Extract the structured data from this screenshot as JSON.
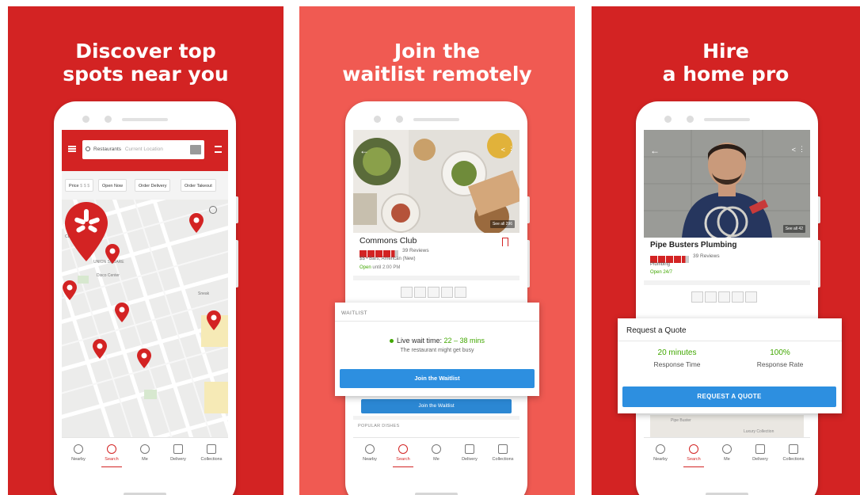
{
  "colors": {
    "brand_red": "#d32323",
    "coral": "#f05a52",
    "action_blue": "#2d8fe0",
    "success_green": "#41a700"
  },
  "panel1": {
    "headline": [
      "Discover top",
      "spots near you"
    ],
    "search": {
      "term": "Restaurants",
      "location": "Current Location"
    },
    "filters": [
      "Price",
      "Open Now",
      "Order Delivery",
      "Order Takeout"
    ],
    "price_symbols": "$ $ $",
    "map_labels": [
      "CENTER",
      "UNION SQUARE",
      "Disco Center",
      "Sneak"
    ]
  },
  "bottom_nav": [
    "Nearby",
    "Search",
    "Me",
    "Delivery",
    "Collections"
  ],
  "panel2": {
    "headline": [
      "Join the",
      "waitlist remotely"
    ],
    "see_all": "See all 296",
    "business": "Commons Club",
    "review_count": "39 Reviews",
    "meta": "$$ • Bars, American (New)",
    "open_label": "Open",
    "open_hours": "until 2:00 PM",
    "waitlist_label": "WAITLIST",
    "live_wait_label": "Live wait time:",
    "live_wait_value": "22 – 38 mins",
    "wait_sub": "The restaurant might get busy",
    "join_button": "Join the Waitlist",
    "popular_label": "POPULAR DISHES"
  },
  "panel3": {
    "headline": [
      "Hire",
      "a home pro"
    ],
    "see_all": "See all 42",
    "business": "Pipe Busters Plumbing",
    "review_count": "39 Reviews",
    "category": "Plumbing",
    "open_text": "Open 24/7",
    "quote_title": "Request a Quote",
    "response_time_value": "20 minutes",
    "response_time_label": "Response Time",
    "response_rate_value": "100%",
    "response_rate_label": "Response Rate",
    "quote_button": "REQUEST A QUOTE",
    "map_strip_labels": [
      "Pipe Buster",
      "Luxury Collection"
    ]
  }
}
